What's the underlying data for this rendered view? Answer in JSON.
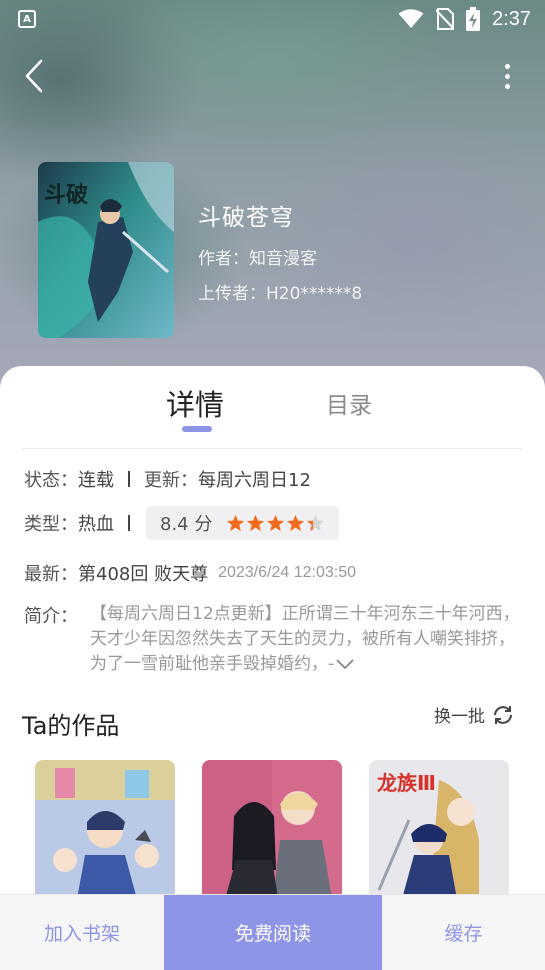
{
  "status_bar": {
    "notification_icon_letter": "A",
    "time": "2:37"
  },
  "book": {
    "title": "斗破苍穹",
    "author": "作者：知音漫客",
    "uploader": "上传者：H20******8"
  },
  "tabs": [
    {
      "label": "详情",
      "active": true
    },
    {
      "label": "目录",
      "active": false
    }
  ],
  "details": {
    "status_label": "状态：",
    "status_value": "连载",
    "update_label": "更新：",
    "update_value": "每周六周日12",
    "type_label": "类型：",
    "type_value": "热血",
    "rating": "8.4 分",
    "rating_stars": 4.2,
    "latest_label": "最新：",
    "latest_value": "第408回 败天尊",
    "latest_time": "2023/6/24 12:03:50",
    "intro_label": "简介：",
    "intro_text": "【每周六周日12点更新】正所谓三十年河东三十年河西，天才少年因忽然失去了天生的灵力，被所有人嘲笑排挤，为了一雪前耻他亲手毁掉婚约，-"
  },
  "works": {
    "title": "Ta的作品",
    "refresh_label": "换一批"
  },
  "bottom_bar": {
    "add_shelf": "加入书架",
    "free_read": "免费阅读",
    "cache": "缓存"
  },
  "colors": {
    "accent": "#8e95e6",
    "star": "#f36b1c"
  }
}
